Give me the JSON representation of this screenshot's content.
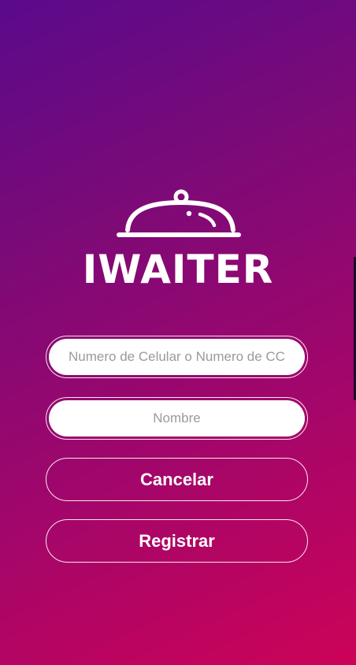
{
  "app": {
    "brand_name": "IWAITER",
    "logo_icon": "serving-cloche-icon"
  },
  "form": {
    "phone_or_id_placeholder": "Numero de Celular o Numero de CC",
    "phone_or_id_value": "",
    "name_placeholder": "Nombre",
    "name_value": ""
  },
  "actions": {
    "cancel_label": "Cancelar",
    "register_label": "Registrar"
  },
  "colors": {
    "gradient_top_left": "#5a0a8c",
    "gradient_bottom_right": "#cc0358",
    "foreground": "#ffffff"
  }
}
